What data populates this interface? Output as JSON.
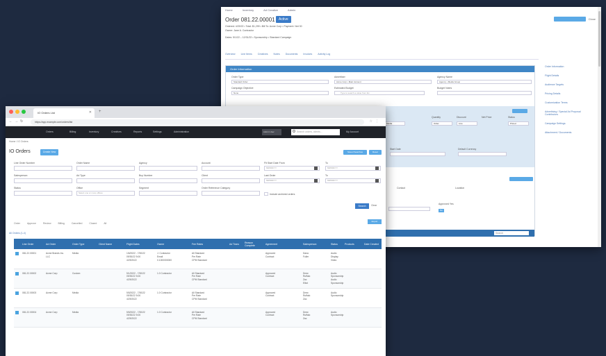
{
  "back_window": {
    "top_nav": [
      "Home",
      "Inventory",
      "Ad Creative",
      "Admin"
    ],
    "order_title": "Order 081.22.00001",
    "status": "Active",
    "meta_lines": [
      "Ordered: 4/29/22 • Total: $1,299 • Bill To: Acme Corp • Payment: Net 30",
      "Owner: Jane A. Contractor",
      "Dates: 5/1/22 – 12/31/22 • Sponsorship • Standard Campaign"
    ],
    "top_link": "Close",
    "tabs": [
      "Overview",
      "Line Items",
      "Creatives",
      "Notes",
      "Documents",
      "Invoices",
      "Activity Log"
    ],
    "panel_title": "Order Information",
    "fields": [
      {
        "label": "Order Type",
        "value": "Standard Order"
      },
      {
        "label": "Advertiser",
        "value": "Acme Corp • Main Account"
      },
      {
        "label": "Agency Name",
        "value": "Agency • Media Group"
      },
      {
        "label": "Campaign Objective",
        "value": "None"
      },
      {
        "label": "Estimated Budget",
        "value": "Type to search a value from list"
      },
      {
        "label": "Budget Notes",
        "value": ""
      }
    ],
    "grid_headers": [
      "Quantity",
      "Discount",
      "Net Price",
      "Status"
    ],
    "grid_row": [
      "Media",
      "Order",
      "Line",
      "Priced"
    ],
    "section_labels": [
      "Start Date",
      "Default Currency"
    ],
    "lower_labels": [
      "Contact",
      "Location"
    ],
    "approval_label": "Approved Yes",
    "toggle": "No",
    "footer_search": "Search",
    "side_items": [
      "Order Information",
      "Flight Details",
      "Audience Targets",
      "Pricing Details",
      "Customization Terms",
      "Advertising / Special Ad Proposal Contributors",
      "Campaign Settings",
      "Attachment / Documents"
    ]
  },
  "front_window": {
    "tab_title": "IO Orders List",
    "url": "https://app.example.com/orders/list",
    "app_nav": [
      "Orders",
      "Billing",
      "Inventory",
      "Creatives",
      "Reports",
      "Settings",
      "Administration"
    ],
    "user_chip": "Admin User",
    "search_placeholder": "Search orders, clients...",
    "account": "My Account",
    "breadcrumb": "Home / IO Orders",
    "page_title": "IO Orders",
    "create_button": "Create New",
    "saved_searches": "Saved Searches",
    "reset": "Reset",
    "filters": [
      {
        "label": "Line Order Number",
        "value": ""
      },
      {
        "label": "Order Name",
        "value": ""
      },
      {
        "label": "Agency",
        "value": ""
      },
      {
        "label": "Account",
        "value": ""
      },
      {
        "label": "Flt Start Date From",
        "value": "MM/DD/YY"
      },
      {
        "label": "To",
        "value": "MM/DD/YY"
      },
      {
        "label": "Salesperson",
        "value": ""
      },
      {
        "label": "Ad Type",
        "value": ""
      },
      {
        "label": "Buy Number",
        "value": ""
      },
      {
        "label": "Client",
        "value": ""
      },
      {
        "label": "Last Order",
        "value": "MM/DD/YY"
      },
      {
        "label": "To",
        "value": "MM/DD/YY"
      },
      {
        "label": "Status",
        "value": ""
      },
      {
        "label": "Office",
        "value": "Select one or more offices"
      },
      {
        "label": "Segment",
        "value": ""
      },
      {
        "label": "Order Reference Category",
        "value": ""
      },
      {
        "label": "Include archived orders",
        "value": ""
      }
    ],
    "search_button": "Search",
    "clear_button": "Clear",
    "sub_tabs": [
      "Order",
      "Approve",
      "Review",
      "Billing",
      "Cancelled",
      "Closed",
      "All"
    ],
    "export_button": "Export",
    "result_count": "All Orders (1-4)",
    "table_headers": [
      "Line Order",
      "Ad Order",
      "Order Type",
      "Client Name",
      "Flight Dates",
      "Owner",
      "Fee Rates",
      "Ad Trans",
      "Reason Complete",
      "Agreement",
      "Salesperson",
      "Status",
      "Products",
      "Date Created"
    ],
    "rows": [
      {
        "line": "081.22.00001",
        "ad_order": [
          "Acme Brands Inc.",
          "LLC"
        ],
        "type": "Media",
        "client": "",
        "flight": [
          "1/6/2022 - 7/30/22",
          "09/30/22 5:00",
          "4/29/2022"
        ],
        "owner": [
          "J. Contractor",
          "Email",
          "0.1000000000"
        ],
        "fees": [
          "All Standard",
          "Per Rate",
          "CPM Standard"
        ],
        "status_lines": [
          "Approved",
          "Contract"
        ],
        "salesperson": [
          "Dana",
          "Fuller"
        ],
        "products": [
          "Audio",
          "Display",
          "Video"
        ],
        "date": ""
      },
      {
        "line": "081.22.00002",
        "ad_order": [
          "Acme Corp"
        ],
        "type": "Custom",
        "client": "",
        "flight": [
          "5/1/2022 - 7/30/22",
          "09/30/22 5:00",
          "4/29/2022"
        ],
        "owner": [
          "1.0 Contractor"
        ],
        "fees": [
          "All Standard",
          "Per Rate",
          "CPM Standard"
        ],
        "status_lines": [
          "Approved",
          "Contract"
        ],
        "salesperson": [
          "Drew",
          "Ruffalo",
          "Zac",
          "Elliot"
        ],
        "products": [
          "Audio",
          "Sponsorship",
          "Audio",
          "Sponsorship"
        ],
        "date": ""
      },
      {
        "line": "081.22.00003",
        "ad_order": [
          "Acme Corp"
        ],
        "type": "Media",
        "client": "",
        "flight": [
          "5/5/2022 - 7/30/22",
          "09/30/22 5:00",
          "4/29/2022"
        ],
        "owner": [
          "1.0 Contractor"
        ],
        "fees": [
          "All Standard",
          "Per Rate",
          "CPM Standard"
        ],
        "status_lines": [
          "Approved",
          "Contract"
        ],
        "salesperson": [
          "Drew",
          "Ruffalo",
          "Zac"
        ],
        "products": [
          "Audio",
          "Sponsorship"
        ],
        "date": ""
      },
      {
        "line": "081.22.00004",
        "ad_order": [
          "Acme Corp"
        ],
        "type": "Media",
        "client": "",
        "flight": [
          "5/5/2022 - 7/30/22",
          "09/30/22 5:00",
          "4/29/2022"
        ],
        "owner": [
          "1.0 Contractor"
        ],
        "fees": [
          "All Standard",
          "Per Rate",
          "CPM Standard"
        ],
        "status_lines": [
          "Approved",
          "Contract"
        ],
        "salesperson": [
          "Drew",
          "Ruffalo",
          "Zac"
        ],
        "products": [
          "Audio",
          "Sponsorship"
        ],
        "date": ""
      }
    ]
  },
  "colors": {
    "background": "#1e2a40",
    "accent": "#3a7bc8",
    "header": "#2f6fae",
    "nav": "#1f2228"
  }
}
